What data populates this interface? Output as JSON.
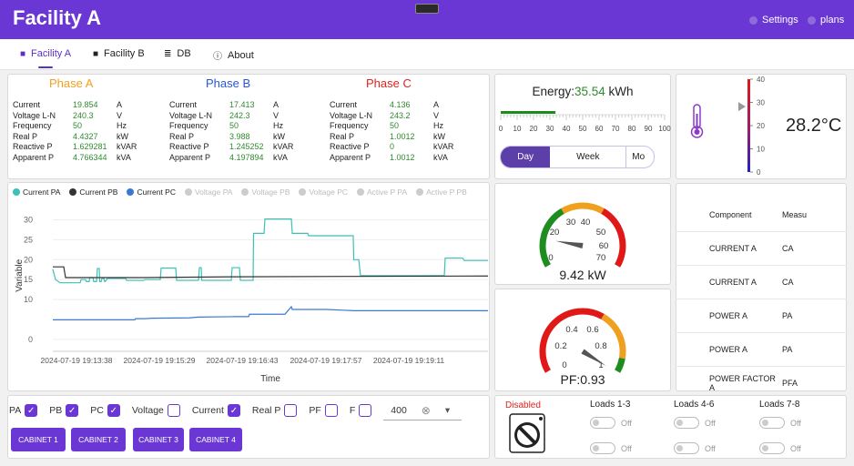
{
  "app": {
    "title": "Facility A",
    "settings_label": "Settings",
    "user_label": "plans"
  },
  "tabs": [
    {
      "label": "Facility A",
      "icon": "building-icon"
    },
    {
      "label": "Facility B",
      "icon": "building-icon"
    },
    {
      "label": "DB",
      "icon": "database-icon"
    },
    {
      "label": "About",
      "icon": "info-icon"
    }
  ],
  "phases": [
    {
      "name": "Phase A",
      "color": "#f0a020",
      "rows": [
        [
          "Current",
          "19.854",
          "A"
        ],
        [
          "Voltage L-N",
          "240.3",
          "V"
        ],
        [
          "Frequency",
          "50",
          "Hz"
        ],
        [
          "Real P",
          "4.4327",
          "kW"
        ],
        [
          "Reactive P",
          "1.629281",
          "kVAR"
        ],
        [
          "Apparent P",
          "4.766344",
          "kVA"
        ]
      ]
    },
    {
      "name": "Phase B",
      "color": "#2a55d6",
      "rows": [
        [
          "Current",
          "17.413",
          "A"
        ],
        [
          "Voltage L-N",
          "242.3",
          "V"
        ],
        [
          "Frequency",
          "50",
          "Hz"
        ],
        [
          "Real P",
          "3.988",
          "kW"
        ],
        [
          "Reactive P",
          "1.245252",
          "kVAR"
        ],
        [
          "Apparent P",
          "4.197894",
          "kVA"
        ]
      ]
    },
    {
      "name": "Phase C",
      "color": "#e0231f",
      "rows": [
        [
          "Current",
          "4.136",
          "A"
        ],
        [
          "Voltage L-N",
          "243.2",
          "V"
        ],
        [
          "Frequency",
          "50",
          "Hz"
        ],
        [
          "Real P",
          "1.0012",
          "kW"
        ],
        [
          "Reactive P",
          "0",
          "kVAR"
        ],
        [
          "Apparent P",
          "1.0012",
          "kVA"
        ]
      ]
    }
  ],
  "energy": {
    "label": "Energy:",
    "value": "35.54",
    "unit": "kWh",
    "scale": [
      "0",
      "10",
      "20",
      "30",
      "40",
      "50",
      "60",
      "70",
      "80",
      "90",
      "100"
    ],
    "level": 35.54,
    "periods": [
      "Day",
      "Week",
      "Mo"
    ]
  },
  "temperature": {
    "value": "28.2°C",
    "scale": [
      "40",
      "30",
      "20",
      "10",
      "0"
    ],
    "level": 28.2
  },
  "power_gauge": {
    "ticks": [
      "0",
      "20",
      "30",
      "40",
      "50",
      "60",
      "70"
    ],
    "value_text": "9.42 kW",
    "value": 9.42
  },
  "pf_gauge": {
    "ticks": [
      "0",
      "0.2",
      "0.4",
      "0.6",
      "0.8",
      "1"
    ],
    "value_text": "PF:0.93",
    "value": 0.93
  },
  "components": {
    "headers": [
      "Component",
      "Measu"
    ],
    "rows": [
      [
        "CURRENT A",
        "CA"
      ],
      [
        "CURRENT A",
        "CA"
      ],
      [
        "POWER A",
        "PA"
      ],
      [
        "POWER A",
        "PA"
      ],
      [
        "POWER FACTOR A",
        "PFA"
      ]
    ]
  },
  "chart_data": {
    "type": "line",
    "ylabel": "Variable",
    "xlabel": "Time",
    "legend": [
      {
        "name": "Current PA",
        "color": "#3cc1b6",
        "active": true
      },
      {
        "name": "Current PB",
        "color": "#333333",
        "active": true
      },
      {
        "name": "Current PC",
        "color": "#3a79d3",
        "active": true
      },
      {
        "name": "Voltage PA",
        "color": "#cccccc",
        "active": false
      },
      {
        "name": "Voltage PB",
        "color": "#cccccc",
        "active": false
      },
      {
        "name": "Voltage PC",
        "color": "#cccccc",
        "active": false
      },
      {
        "name": "Active P PA",
        "color": "#cccccc",
        "active": false
      },
      {
        "name": "Active P PB",
        "color": "#cccccc",
        "active": false
      }
    ],
    "yticks": [
      0,
      10,
      15,
      20,
      25,
      30
    ],
    "ylim": [
      -3,
      34
    ],
    "xticks": [
      "2024-07-19 19:13:38",
      "2024-07-19 19:15:29",
      "2024-07-19 19:16:43",
      "2024-07-19 19:17:57",
      "2024-07-19 19:19:11"
    ],
    "series": [
      {
        "name": "Current PA",
        "color": "#3cc1b6",
        "x": [
          0,
          3,
          8,
          30,
          31,
          36,
          37,
          40,
          40.5,
          44,
          45,
          48,
          49,
          51,
          51.5,
          53,
          54,
          56,
          57,
          57.5,
          60,
          60.5,
          80,
          81,
          100,
          101,
          118,
          119,
          135,
          136,
          138,
          160,
          161,
          163,
          163.5,
          196,
          197,
          205,
          206,
          220,
          220.5,
          232,
          233,
          262,
          263,
          280,
          281,
          300,
          330,
          330.5,
          336,
          338,
          360,
          361,
          430,
          431,
          450,
          452,
          478
        ],
        "y": [
          17.6,
          15,
          14.2,
          14.2,
          15,
          15,
          14.5,
          14.5,
          15.5,
          15.5,
          14.5,
          14.5,
          17.8,
          17.8,
          14.5,
          14.5,
          15.3,
          15.3,
          14.5,
          14.5,
          15.3,
          15.3,
          15.3,
          14.8,
          14.8,
          15,
          15,
          17.9,
          17.9,
          14.8,
          14.8,
          14.8,
          18,
          18,
          14.8,
          14.8,
          18,
          18,
          14.8,
          14.8,
          26.6,
          26.6,
          30.2,
          30.2,
          26.6,
          26.6,
          26,
          26,
          26,
          20,
          20,
          16,
          16,
          16,
          16,
          20.4,
          20.4,
          19.8,
          19.8
        ]
      },
      {
        "name": "Current PB",
        "color": "#333333",
        "x": [
          0,
          12,
          14,
          30,
          100,
          200,
          330,
          478
        ],
        "y": [
          18.2,
          18.2,
          15.5,
          15.5,
          15.5,
          15.7,
          15.8,
          15.9
        ]
      },
      {
        "name": "Current PC",
        "color": "#3a79d3",
        "x": [
          0,
          90,
          91,
          100,
          110,
          150,
          160,
          200,
          215,
          216,
          255,
          262,
          263,
          300,
          330,
          478
        ],
        "y": [
          4.9,
          4.9,
          5.2,
          5.2,
          5.3,
          5.4,
          5.6,
          5.7,
          5.7,
          6.3,
          6.3,
          8.2,
          7.5,
          7.5,
          7.2,
          7.2
        ]
      }
    ]
  },
  "controls": {
    "labels": [
      "PA",
      "PB",
      "PC",
      "Voltage",
      "Current",
      "Real P",
      "PF",
      "F"
    ],
    "checked": [
      true,
      true,
      true,
      false,
      true,
      false,
      false,
      false
    ],
    "limit_value": "400",
    "clear_icon": "⊗",
    "dropdown_icon": "▾"
  },
  "cabinets": [
    "CABINET 1",
    "CABINET 2",
    "CABINET 3",
    "CABINET 4"
  ],
  "loads": {
    "status": "Disabled",
    "groups": [
      "Loads 1-3",
      "Loads 4-6",
      "Loads 7-8"
    ],
    "toggle_label": "Off"
  }
}
